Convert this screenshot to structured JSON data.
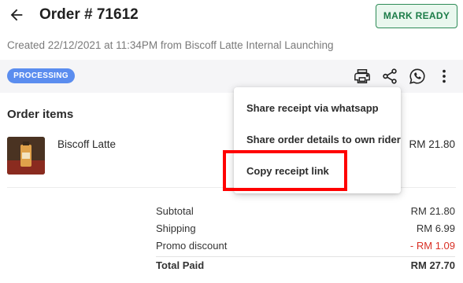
{
  "header": {
    "title": "Order # 71612",
    "mark_ready_label": "MARK READY"
  },
  "order": {
    "created_text": "Created 22/12/2021 at 11:34PM from Biscoff Latte Internal Launching",
    "status": "PROCESSING"
  },
  "toolbar": {
    "icons": [
      "printer-icon",
      "share-icon",
      "whatsapp-icon",
      "more-vert-icon"
    ]
  },
  "items_section": {
    "title": "Order items",
    "items": [
      {
        "name": "Biscoff Latte",
        "price": "RM 21.80"
      }
    ]
  },
  "summary": {
    "rows": [
      {
        "label": "Subtotal",
        "value": "RM 21.80"
      },
      {
        "label": "Shipping",
        "value": "RM 6.99"
      },
      {
        "label": "Promo discount",
        "value": "- RM 1.09"
      },
      {
        "label": "Total Paid",
        "value": "RM 27.70"
      }
    ]
  },
  "menu": {
    "items": [
      {
        "label": "Share receipt via whatsapp"
      },
      {
        "label": "Share order details to own rider"
      },
      {
        "label": "Copy receipt link"
      }
    ],
    "highlighted_index": 2
  },
  "colors": {
    "accent_green": "#1c7c48",
    "badge_blue": "#5b8def",
    "discount_red": "#d93025",
    "highlight_red": "#ff0000"
  }
}
